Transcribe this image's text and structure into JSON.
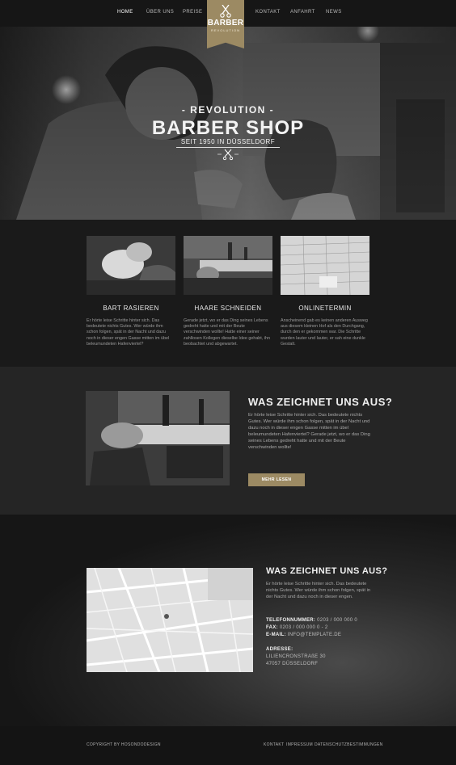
{
  "nav": {
    "items": [
      {
        "label": "HOME",
        "active": true
      },
      {
        "label": "ÜBER UNS"
      },
      {
        "label": "PREISE"
      },
      {
        "label": "KONTAKT"
      },
      {
        "label": "ANFAHRT"
      },
      {
        "label": "NEWS"
      }
    ],
    "logo": {
      "line1": "BARBER",
      "line2": "REVOLUTION",
      "icon": "scissors-icon"
    }
  },
  "hero": {
    "kicker": "- REVOLUTION -",
    "title": "BARBER SHOP",
    "since": "SEIT 1950 IN DÜSSELDORF",
    "ornament_icon": "scissors-icon"
  },
  "services": [
    {
      "title": "BART RASIEREN",
      "text": "Er hörte leise Schritte hinter sich. Das bedeutete nichts Gutes. Wer würde ihm schon folgen, spät in der Nacht und dazu noch in dieser engen Gasse mitten im übel beleumundeten Hafenviertel?"
    },
    {
      "title": "HAARE SCHNEIDEN",
      "text": "Gerade jetzt, wo er das Ding seines Lebens gedreht hatte und mit der Beute verschwinden wollte! Hatte einer seiner zahllosen Kollegen dieselbe Idee gehabt, ihn beobachtet und abgewartet."
    },
    {
      "title": "ONLINETERMIN",
      "text": "Anscheinend gab es keinen anderen Ausweg aus diesem kleinen Hof als den Durchgang, durch den er gekommen war. Die Schritte wurden lauter und lauter, er sah eine dunkle Gestalt."
    }
  ],
  "feature": {
    "heading": "WAS ZEICHNET UNS AUS?",
    "text": "Er hörte leise Schritte hinter sich. Das bedeutete nichts Gutes. Wer würde ihm schon folgen, spät in der Nacht und dazu noch in dieser engen Gasse mitten im übel beleumundeten Hafenviertel? Gerade jetzt, wo er das Ding seines Lebens gedreht hatte und mit der Beute verschwinden wollte!",
    "button": "MEHR LESEN"
  },
  "contact": {
    "heading": "WAS ZEICHNET UNS AUS?",
    "intro": "Er hörte leise Schritte hinter sich. Das bedeutete nichts Gutes. Wer würde ihm schon folgen, spät in der Nacht und dazu noch in dieser engen.",
    "phone_label": "TELEFONNUMMER:",
    "phone": "0203 / 000 000 0",
    "fax_label": "FAX:",
    "fax": "0203 / 000 000 0 - 2",
    "email_label": "E-MAIL:",
    "email": "INFO@TEMPLATE.DE",
    "address_label": "ADRESSE:",
    "address_line1": "LILIENCRONSTRAßE 30",
    "address_line2": "47057 DÜSSELDORF"
  },
  "footer": {
    "copyright": "COPYRIGHT BY HOSONDODESIGN",
    "links": [
      "KONTAKT",
      "IMPRESSUM",
      "DATENSCHUTZBESTIMMUNGEN"
    ]
  },
  "colors": {
    "accent": "#9c8a63",
    "background": "#1c1c1c",
    "nav": "#161616"
  }
}
